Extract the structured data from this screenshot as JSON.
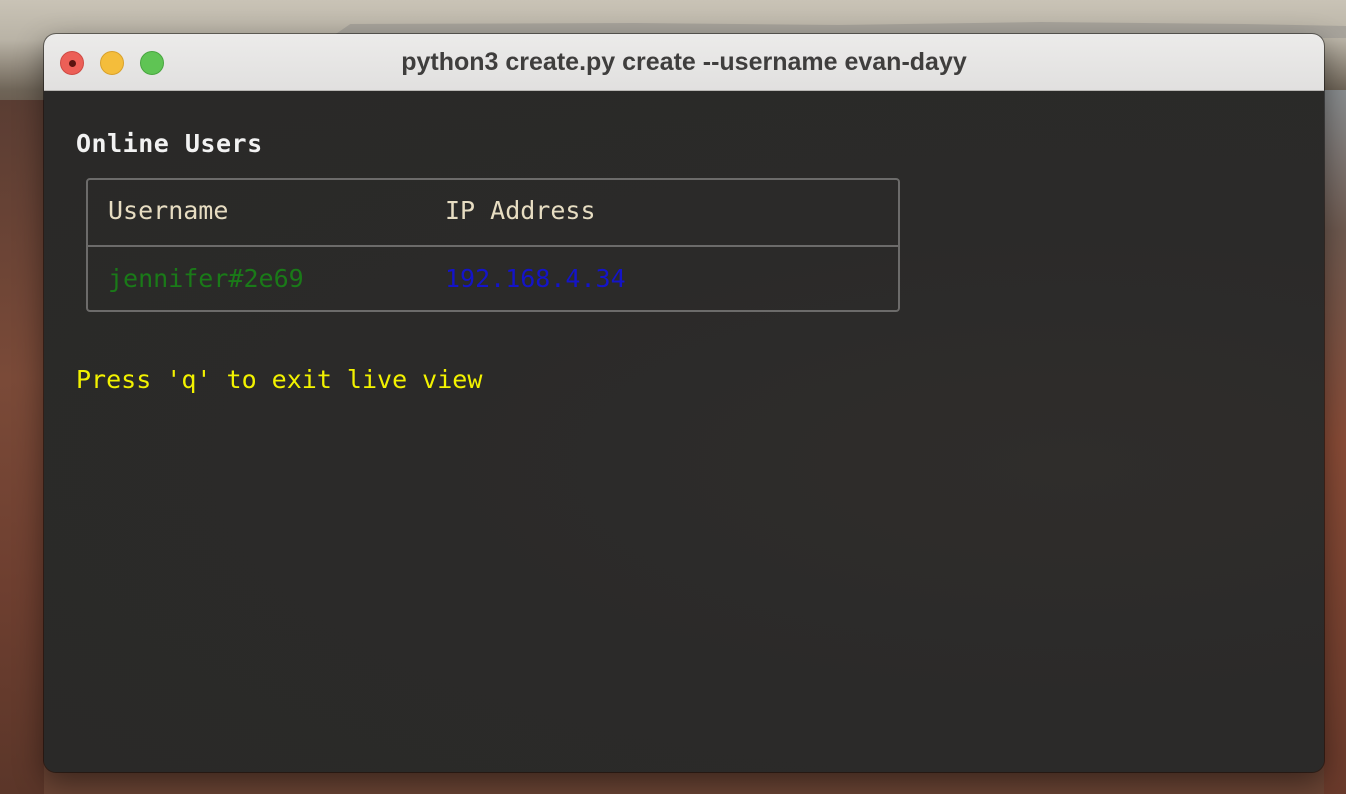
{
  "window": {
    "title": "python3 create.py create --username evan-dayy"
  },
  "terminal": {
    "heading": "Online Users",
    "table": {
      "columns": [
        "Username",
        "IP Address"
      ],
      "rows": [
        {
          "username": "jennifer#2e69",
          "ip": "192.168.4.34"
        }
      ]
    },
    "hint": "Press 'q' to exit live view"
  },
  "colors": {
    "username": "#1a7a18",
    "ip": "#1414c8",
    "hint": "#f2f200",
    "header": "#e7ddc2"
  }
}
